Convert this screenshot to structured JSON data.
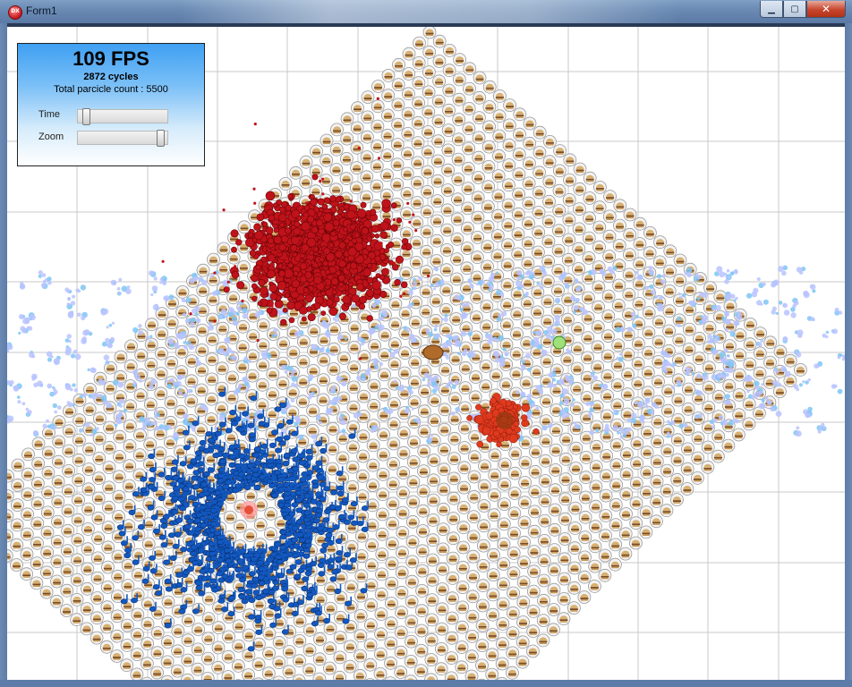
{
  "window": {
    "title": "Form1",
    "app_icon_text": "DX",
    "buttons": {
      "minimize": "▁",
      "maximize": "▢",
      "close": "✕"
    }
  },
  "overlay": {
    "fps": "109 FPS",
    "cycles": "2872 cycles",
    "total": "Total parcicle count : 5500",
    "time_label": "Time",
    "zoom_label": "Zoom",
    "time_value": 0.05,
    "zoom_value": 0.97
  },
  "colors": {
    "red_particles": "#c0121a",
    "blue_particles": "#1258c0",
    "orange_particles": "#e03a1e",
    "light_blue_particles": "#7ec6f5",
    "burger_bun": "#d8b070",
    "grid": "#c8c8c8"
  }
}
